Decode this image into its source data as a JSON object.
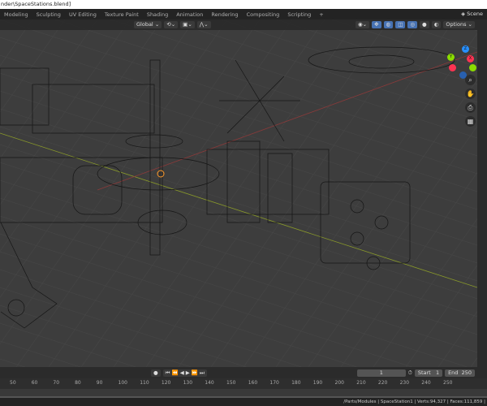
{
  "title": "nder\\SpaceStations.blend]",
  "workspace_tabs": [
    "Modeling",
    "Sculpting",
    "UV Editing",
    "Texture Paint",
    "Shading",
    "Animation",
    "Rendering",
    "Compositing",
    "Scripting",
    "+"
  ],
  "scene_label": "Scene",
  "viewport_header": {
    "orientation": "Global",
    "options": "Options"
  },
  "timeline": {
    "current_frame": "1",
    "start_label": "Start",
    "start": "1",
    "end_label": "End",
    "end": "250"
  },
  "ruler_ticks": [
    "50",
    "60",
    "70",
    "80",
    "90",
    "100",
    "110",
    "120",
    "130",
    "140",
    "150",
    "160",
    "170",
    "180",
    "190",
    "200",
    "210",
    "220",
    "230",
    "240",
    "250"
  ],
  "gizmo": {
    "x": "X",
    "y": "Y",
    "z": "Z"
  },
  "status": "/Parts/Modules | SpaceStation1 | Verts:94,327 | Faces:111,859 |",
  "colors": {
    "x_axis": "#ff3352",
    "y_axis": "#8bdc00",
    "z_axis": "#2890ff",
    "viewport_bg": "#3d3d3d"
  }
}
